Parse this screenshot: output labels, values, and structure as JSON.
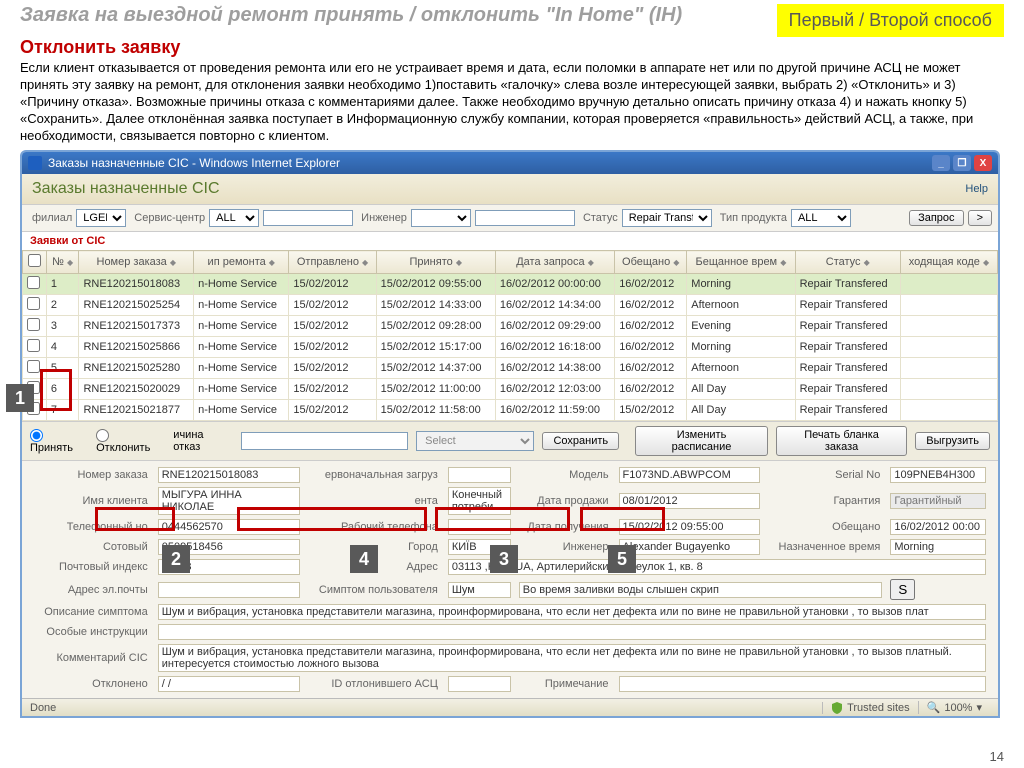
{
  "slide": {
    "title": "Заявка на выездной ремонт принять / отклонить \"In Home\" (IH)",
    "badge": "Первый / Второй способ",
    "reject": "Отклонить заявку",
    "body": "Если клиент отказывается от проведения ремонта или его не устраивает время и дата, если поломки в аппарате нет или по другой причине АСЦ не может принять эту заявку на ремонт, для отклонения заявки необходимо 1)поставить «галочку» слева возле интересующей заявки, выбрать 2) «Отклонить» и 3) «Причину отказа». Возможные причины отказа с комментариями далее. Также необходимо вручную детально описать причину отказа 4) и нажать кнопку 5) «Сохранить». Далее отклонённая заявка поступает в Информационную службу компании, которая проверяется «правильность» действий АСЦ, а также, при необходимости, связывается повторно с клиентом.",
    "pagenum": "14"
  },
  "window": {
    "title": "Заказы назначенные CIC - Windows Internet Explorer",
    "app_title": "Заказы назначенные CIC",
    "help": "Help"
  },
  "filters": {
    "branch_lbl": "филиал",
    "branch": "LGEL",
    "svc_lbl": "Сервис-центр",
    "svc": "ALL",
    "eng_lbl": "Инженер",
    "status_lbl": "Статус",
    "status": "Repair Transf",
    "product_lbl": "Тип продукта",
    "product": "ALL",
    "search_btn": "Запрос",
    "more_btn": ">"
  },
  "section": "Заявки от CIC",
  "grid": {
    "headers": [
      "",
      "№",
      "Номер заказа",
      "ип ремонта",
      "Отправлено",
      "Принято",
      "Дата запроса",
      "Обещано",
      "Бещанное врем",
      "Статус",
      "ходящая коде"
    ],
    "rows": [
      {
        "n": "1",
        "order": "RNE120215018083",
        "type": "n-Home Service",
        "sent": "15/02/2012",
        "recv": "15/02/2012 09:55:00",
        "req": "16/02/2012 00:00:00",
        "prom": "16/02/2012",
        "slot": "Morning",
        "status": "Repair Transfered",
        "sel": true
      },
      {
        "n": "2",
        "order": "RNE120215025254",
        "type": "n-Home Service",
        "sent": "15/02/2012",
        "recv": "15/02/2012 14:33:00",
        "req": "16/02/2012 14:34:00",
        "prom": "16/02/2012",
        "slot": "Afternoon",
        "status": "Repair Transfered"
      },
      {
        "n": "3",
        "order": "RNE120215017373",
        "type": "n-Home Service",
        "sent": "15/02/2012",
        "recv": "15/02/2012 09:28:00",
        "req": "16/02/2012 09:29:00",
        "prom": "16/02/2012",
        "slot": "Evening",
        "status": "Repair Transfered"
      },
      {
        "n": "4",
        "order": "RNE120215025866",
        "type": "n-Home Service",
        "sent": "15/02/2012",
        "recv": "15/02/2012 15:17:00",
        "req": "16/02/2012 16:18:00",
        "prom": "16/02/2012",
        "slot": "Morning",
        "status": "Repair Transfered"
      },
      {
        "n": "5",
        "order": "RNE120215025280",
        "type": "n-Home Service",
        "sent": "15/02/2012",
        "recv": "15/02/2012 14:37:00",
        "req": "16/02/2012 14:38:00",
        "prom": "16/02/2012",
        "slot": "Afternoon",
        "status": "Repair Transfered"
      },
      {
        "n": "6",
        "order": "RNE120215020029",
        "type": "n-Home Service",
        "sent": "15/02/2012",
        "recv": "15/02/2012 11:00:00",
        "req": "16/02/2012 12:03:00",
        "prom": "16/02/2012",
        "slot": "All Day",
        "status": "Repair Transfered"
      },
      {
        "n": "7",
        "order": "RNE120215021877",
        "type": "n-Home Service",
        "sent": "15/02/2012",
        "recv": "15/02/2012 11:58:00",
        "req": "16/02/2012 11:59:00",
        "prom": "15/02/2012",
        "slot": "All Day",
        "status": "Repair Transfered"
      }
    ]
  },
  "actions": {
    "accept": "Принять",
    "reject": "Отклонить",
    "reason_lbl": "ичина отказ",
    "select": "Select",
    "save": "Сохранить",
    "reschedule": "Изменить расписание",
    "print": "Печать бланка заказа",
    "export": "Выгрузить"
  },
  "detail": {
    "order_lbl": "Номер заказа",
    "order": "RNE120215018083",
    "load_lbl": "ервоначальная загруз",
    "model_lbl": "Модель",
    "model": "F1073ND.ABWPCOM",
    "serial_lbl": "Serial No",
    "serial": "109PNEB4H300",
    "name_lbl": "Имя клиента",
    "name": "МЫГУРА ИННА НИКОЛАЕ",
    "client_type_lbl": "ента",
    "client_type": "Конечный потреби",
    "sale_lbl": "Дата продажи",
    "sale": "08/01/2012",
    "warranty_lbl": "Гарантия",
    "warranty": "Гарантийный",
    "phone_lbl": "Телефонный но",
    "phone": "0444562570",
    "workphone_lbl": "Рабочий телефона",
    "recv_lbl": "Дата получения",
    "recv": "15/02/2012 09:55:00",
    "promised_lbl": "Обещано",
    "promised": "16/02/2012 00:00",
    "mobile_lbl": "Сотовый",
    "mobile": "0509518456",
    "city_lbl": "Город",
    "city": "КИЇВ",
    "eng_lbl": "Инженер",
    "eng": "Alexander Bugayenko",
    "slot_lbl": "Назначенное время",
    "slot": "Morning",
    "zip_lbl": "Почтовый индекс",
    "zip": "03113",
    "addr_lbl": "Адрес",
    "addr": "03113 ,Київ ,UA, Артилерийский переулок 1, кв. 8",
    "email_lbl": "Адрес эл.почты",
    "symptom_lbl": "Симптом пользователя",
    "symptom": "Шум",
    "symptom2": "Во время заливки воды слышен скрип",
    "s_btn": "S",
    "desc_lbl": "Описание симптома",
    "desc": "Шум и вибрация, установка представители магазина, проинформирована, что если нет дефекта или по вине не правильной утановки , то вызов плат",
    "instr_lbl": "Особые инструкции",
    "comment_lbl": "Комментарий CIC",
    "comment": "Шум и вибрация, установка представители магазина, проинформирована, что если нет дефекта или по вине не правильной утановки , то вызов платный. интересуется стоимостью ложного вызова",
    "rejected_lbl": "Отклонено",
    "rejected": "/ /",
    "rejid_lbl": "ID отлонившего АСЦ",
    "note_lbl": "Примечание"
  },
  "status": {
    "done": "Done",
    "trusted": "Trusted sites",
    "zoom": "100%"
  },
  "callouts": {
    "c1": "1",
    "c2": "2",
    "c3": "3",
    "c4": "4",
    "c5": "5"
  }
}
